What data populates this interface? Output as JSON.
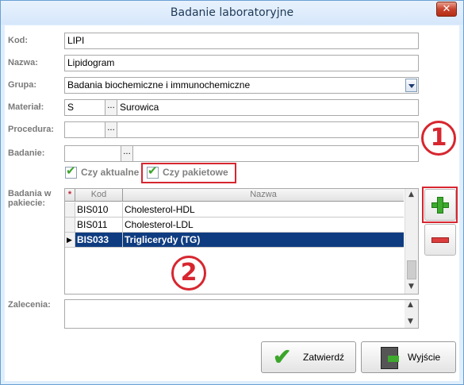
{
  "window": {
    "title": "Badanie laboratoryjne",
    "close_glyph": "✕"
  },
  "form": {
    "kod": {
      "label": "Kod:",
      "value": "LIPI"
    },
    "nazwa": {
      "label": "Nazwa:",
      "value": "Lipidogram"
    },
    "grupa": {
      "label": "Grupa:",
      "value": "Badania biochemiczne i immunochemiczne"
    },
    "material": {
      "label": "Materiał:",
      "code": "S",
      "name": "Surowica"
    },
    "procedura": {
      "label": "Procedura:",
      "value": ""
    },
    "badanie": {
      "label": "Badanie:",
      "value": ""
    },
    "dots": "...",
    "czy_aktualne": {
      "label": "Czy aktualne",
      "checked": true
    },
    "czy_pakietowe": {
      "label": "Czy pakietowe",
      "checked": true
    },
    "badania_w_pakiecie": {
      "label": "Badania w pakiecie:"
    },
    "zalecenia": {
      "label": "Zalecenia:",
      "value": ""
    }
  },
  "grid": {
    "columns": [
      "Kod",
      "Nazwa"
    ],
    "required_marker": "*",
    "rows": [
      {
        "kod": "BIS010",
        "nazwa": "Cholesterol-HDL",
        "selected": false
      },
      {
        "kod": "BIS011",
        "nazwa": "Cholesterol-LDL",
        "selected": false
      },
      {
        "kod": "BIS033",
        "nazwa": "Triglicerydy (TG)",
        "selected": true
      }
    ],
    "row_pointer": "▶"
  },
  "annotations": {
    "marker1": "1",
    "marker2": "2",
    "color": "#d7262f"
  },
  "buttons": {
    "confirm": "Zatwierdź",
    "exit": "Wyjście"
  },
  "icons": {
    "add": "plus-icon",
    "remove": "minus-icon",
    "confirm": "check-icon",
    "exit": "exit-door-icon"
  }
}
